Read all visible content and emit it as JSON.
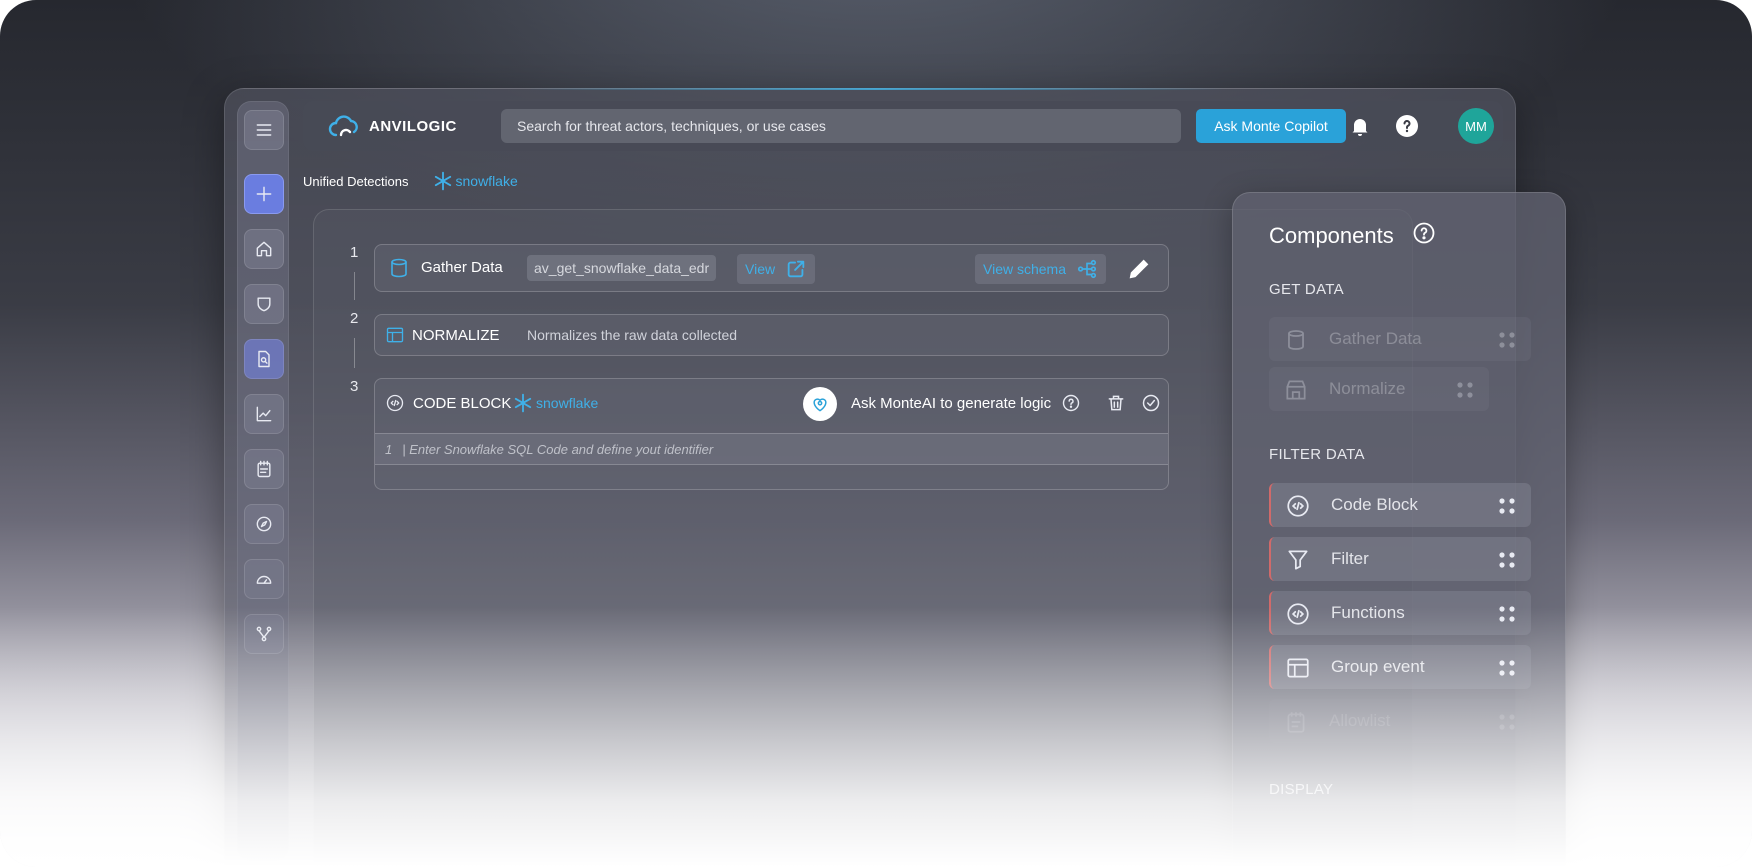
{
  "header": {
    "logo_text": "ANVILOGIC",
    "search_placeholder": "Search for threat actors, techniques, or use cases",
    "copilot_label": "Ask Monte Copilot",
    "avatar_initials": "MM"
  },
  "breadcrumb": {
    "title": "Unified Detections",
    "brand": "snowflake"
  },
  "steps": [
    {
      "number": "1",
      "title": "Gather Data",
      "dataset": "av_get_snowflake_data_edr",
      "view_label": "View",
      "schema_label": "View schema"
    },
    {
      "number": "2",
      "title": "NORMALIZE",
      "description": "Normalizes the raw data collected"
    },
    {
      "number": "3",
      "title": "CODE BLOCK",
      "brand": "snowflake",
      "ai_label": "Ask MonteAI to generate logic",
      "line_number": "1",
      "code_placeholder": "| Enter Snowflake SQL Code and define yout identifier"
    }
  ],
  "components": {
    "title": "Components",
    "sections": [
      {
        "label": "GET DATA",
        "items": [
          "Gather Data",
          "Normalize"
        ]
      },
      {
        "label": "FILTER DATA",
        "items": [
          "Code Block",
          "Filter",
          "Functions",
          "Group event",
          "Allowlist"
        ]
      },
      {
        "label": "DISPLAY",
        "items": []
      }
    ]
  },
  "colors": {
    "accent": "#2aa2d9",
    "snowflake": "#3fb0e8",
    "avatar": "#1fa59a",
    "sidebar_add": "#6a7de0"
  }
}
